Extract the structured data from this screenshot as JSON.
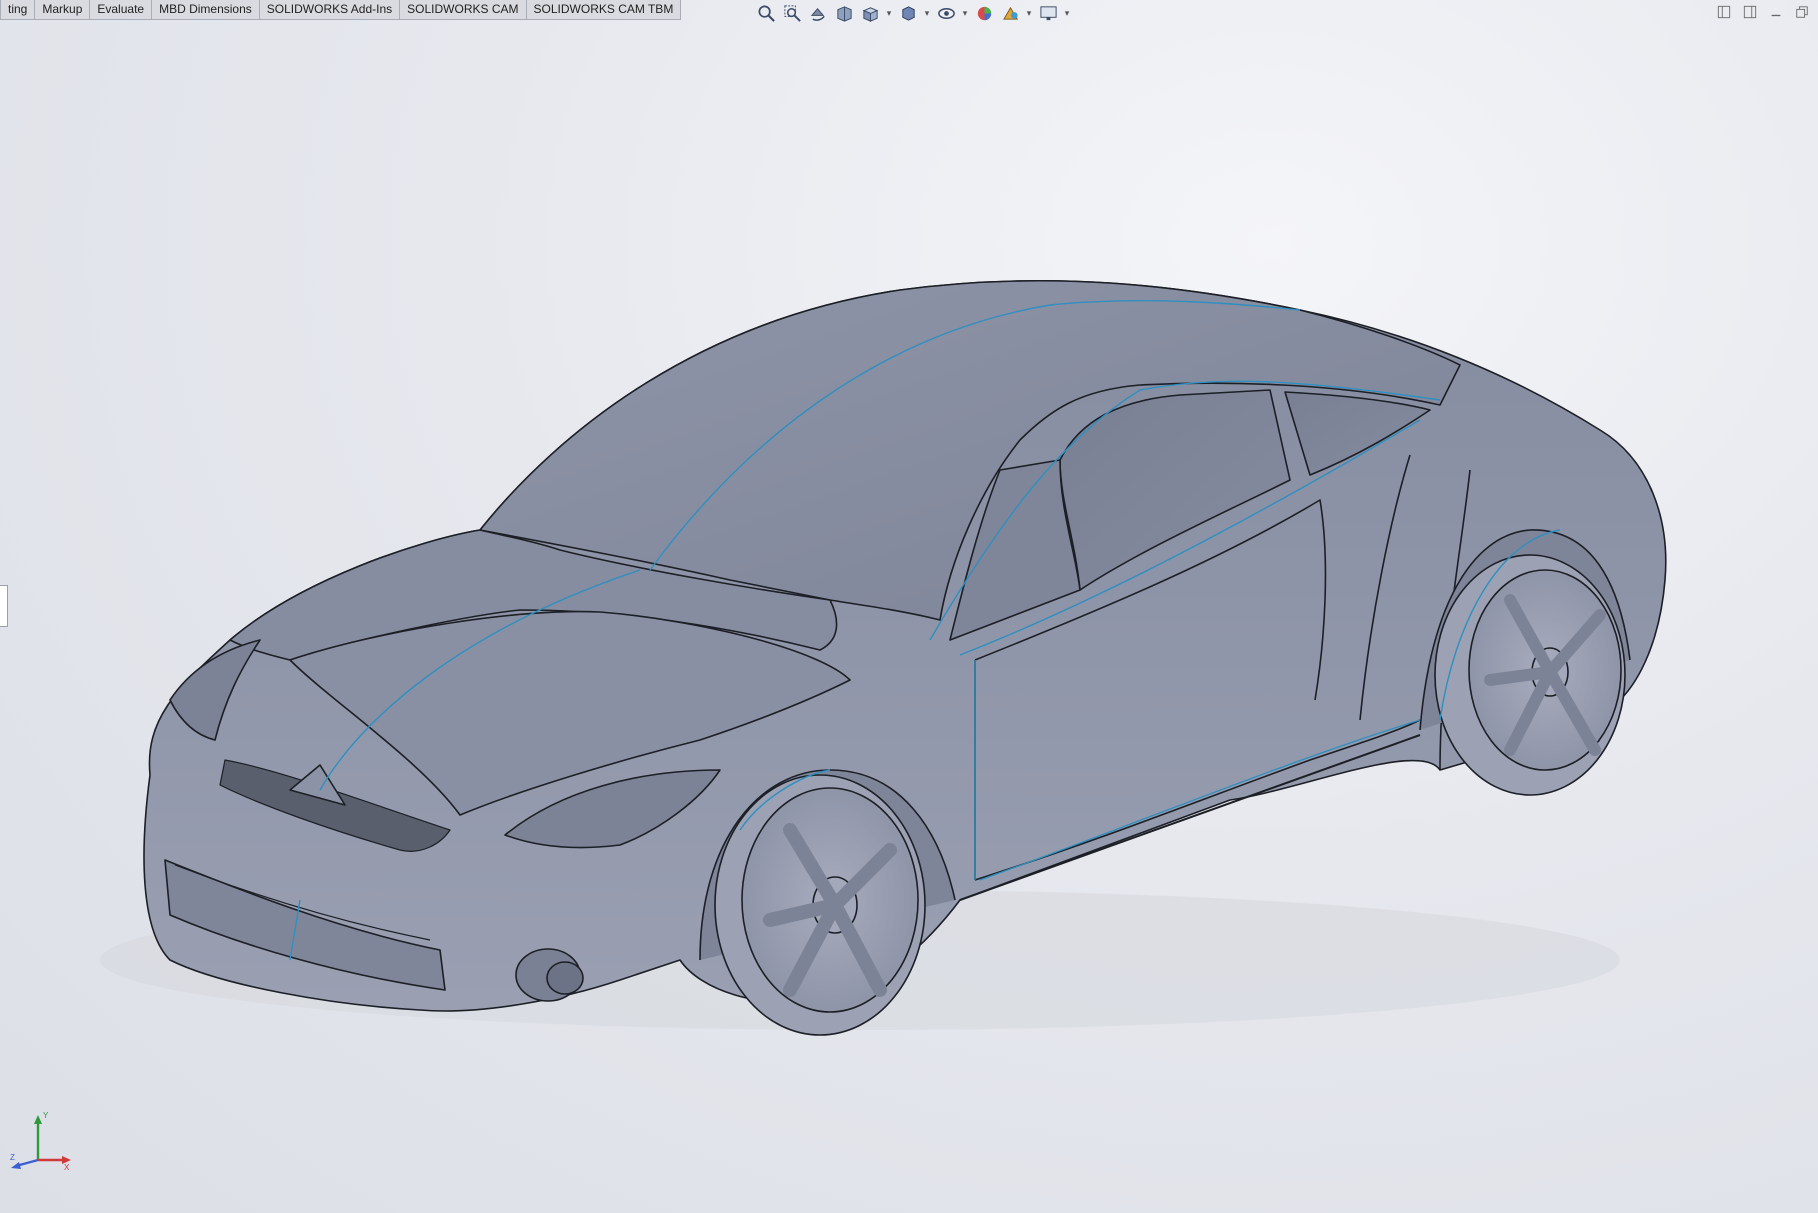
{
  "tabs": [
    {
      "label": "ting"
    },
    {
      "label": "Markup"
    },
    {
      "label": "Evaluate"
    },
    {
      "label": "MBD Dimensions"
    },
    {
      "label": "SOLIDWORKS Add-Ins"
    },
    {
      "label": "SOLIDWORKS CAM"
    },
    {
      "label": "SOLIDWORKS CAM TBM"
    }
  ],
  "hud_icons": [
    "zoom-to-fit-icon",
    "zoom-to-area-icon",
    "previous-view-icon",
    "section-view-icon",
    "view-orientation-icon",
    "display-style-icon",
    "hide-show-items-icon",
    "edit-appearance-icon",
    "apply-scene-icon",
    "view-settings-icon"
  ],
  "triad": {
    "x_label": "X",
    "y_label": "Y",
    "z_label": "Z"
  },
  "colors": {
    "body": "#8a90a3",
    "edge": "#1c1f26",
    "split_line": "#2f8fc0",
    "tire": "#9ca2b4",
    "background": "#e6e8ee"
  }
}
